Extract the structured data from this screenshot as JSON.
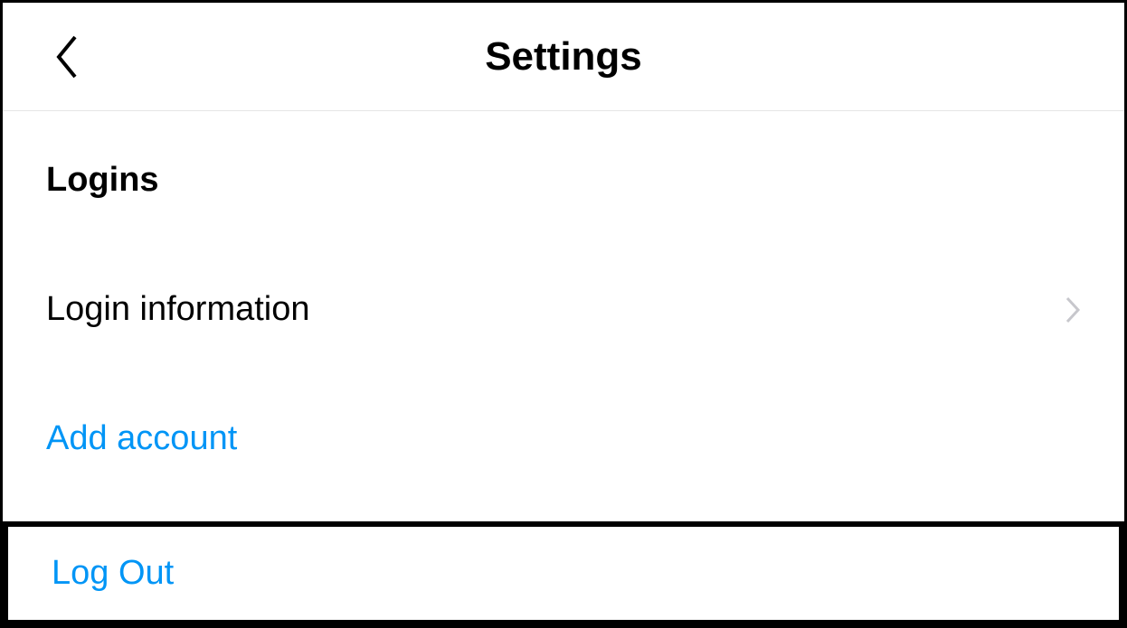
{
  "header": {
    "title": "Settings"
  },
  "section": {
    "heading": "Logins"
  },
  "items": {
    "login_information": "Login information",
    "add_account": "Add account",
    "log_out": "Log Out"
  },
  "colors": {
    "accent": "#0095f6",
    "text": "#000000",
    "chevron": "#c7c7cc"
  }
}
